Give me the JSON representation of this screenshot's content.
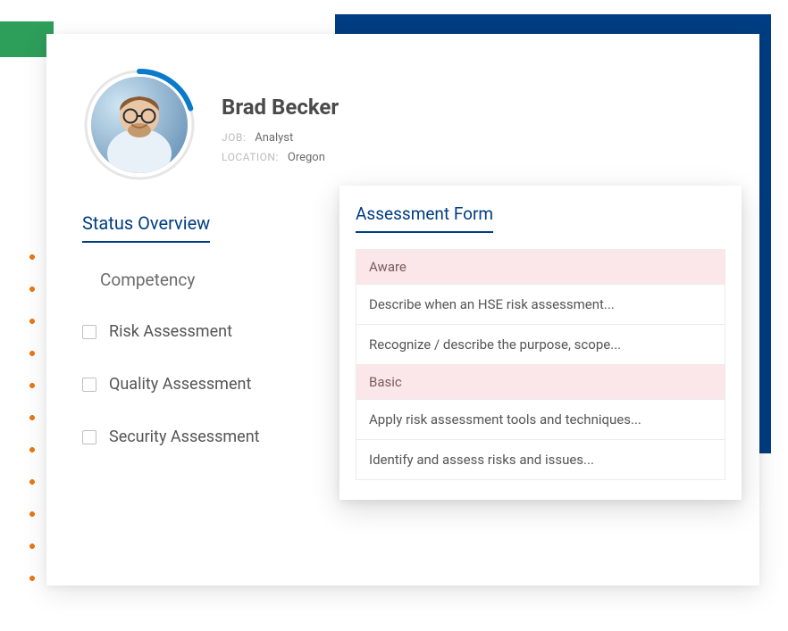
{
  "colors": {
    "accentBlue": "#003d82",
    "accentGreen": "#2e9e5b",
    "dotOrange": "#e87817",
    "groupHeaderBg": "#fbe7ea"
  },
  "profile": {
    "name": "Brad Becker",
    "job_label": "JOB:",
    "job_value": "Analyst",
    "location_label": "LOCATION:",
    "location_value": "Oregon"
  },
  "status": {
    "title": "Status Overview",
    "competency_label": "Competency",
    "items": [
      {
        "label": "Risk Assessment"
      },
      {
        "label": "Quality Assessment"
      },
      {
        "label": "Security Assessment"
      }
    ]
  },
  "assessment": {
    "title": "Assessment Form",
    "groups": [
      {
        "header": "Aware",
        "items": [
          "Describe when an HSE risk assessment...",
          "Recognize / describe the purpose, scope..."
        ]
      },
      {
        "header": "Basic",
        "items": [
          "Apply risk assessment tools and techniques...",
          "Identify and assess risks and issues..."
        ]
      }
    ]
  }
}
